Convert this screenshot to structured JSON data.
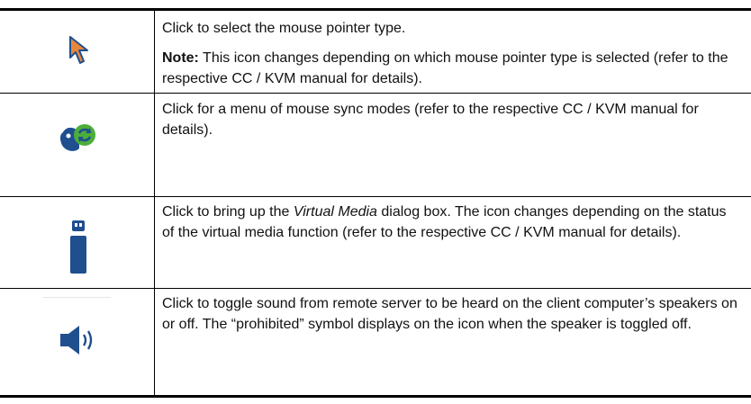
{
  "rows": [
    {
      "icon": "mouse-pointer-icon",
      "desc": "Click to select the mouse pointer type.",
      "note_label": "Note:",
      "note_text": " This icon changes depending on which mouse pointer type is selected (refer to the respective CC / KVM manual for details)."
    },
    {
      "icon": "mouse-sync-icon",
      "desc": "Click for a menu of mouse sync modes (refer to the respective CC / KVM manual for details)."
    },
    {
      "icon": "usb-drive-icon",
      "desc_before": "Click to bring up the ",
      "desc_em": "Virtual Media",
      "desc_after": " dialog box. The icon changes depending on the status of the virtual media function (refer to the respective CC / KVM manual for details)."
    },
    {
      "icon": "speaker-icon",
      "desc": "Click to toggle sound from remote server to be heard on the client computer’s speakers on or off. The “prohibited” symbol displays on the icon when the speaker is toggled off."
    }
  ],
  "colors": {
    "pointer_orange": "#e8873a",
    "icon_blue": "#1f4f8f",
    "sync_green": "#4cae3a"
  }
}
